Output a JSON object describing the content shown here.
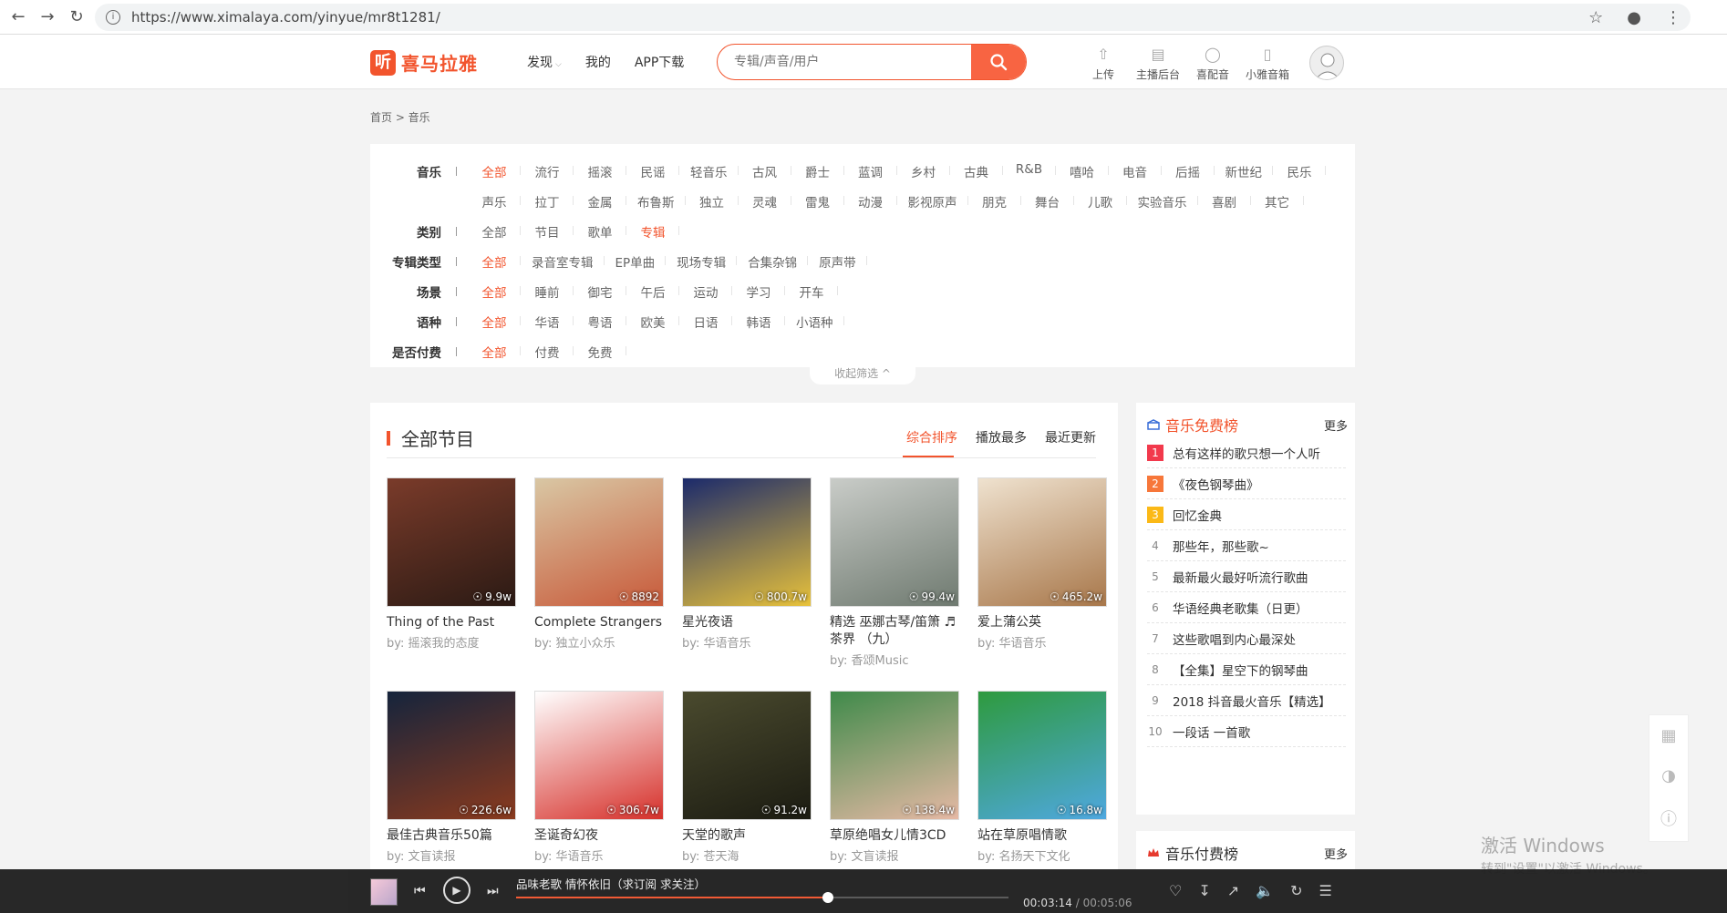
{
  "browser": {
    "url": "https://www.ximalaya.com/yinyue/mr8t1281/"
  },
  "header": {
    "logo_glyph": "听",
    "logo_text": "喜马拉雅",
    "nav": [
      "发现",
      "我的",
      "APP下载"
    ],
    "search_placeholder": "专辑/声音/用户",
    "tools": [
      {
        "label": "上传",
        "icon": "upload-icon"
      },
      {
        "label": "主播后台",
        "icon": "dashboard-icon"
      },
      {
        "label": "喜配音",
        "icon": "dubbing-icon"
      },
      {
        "label": "小雅音箱",
        "icon": "speaker-icon"
      }
    ]
  },
  "breadcrumb": "首页 > 音乐",
  "filters": [
    {
      "label": "音乐",
      "items": [
        "全部",
        "流行",
        "摇滚",
        "民谣",
        "轻音乐",
        "古风",
        "爵士",
        "蓝调",
        "乡村",
        "古典",
        "R&B",
        "嘻哈",
        "电音",
        "后摇",
        "新世纪",
        "民乐"
      ],
      "active": 0
    },
    {
      "label": "",
      "items": [
        "声乐",
        "拉丁",
        "金属",
        "布鲁斯",
        "独立",
        "灵魂",
        "雷鬼",
        "动漫",
        "影视原声",
        "朋克",
        "舞台",
        "儿歌",
        "实验音乐",
        "喜剧",
        "其它"
      ],
      "active": -1
    },
    {
      "label": "类别",
      "items": [
        "全部",
        "节目",
        "歌单",
        "专辑"
      ],
      "active": 3
    },
    {
      "label": "专辑类型",
      "items": [
        "全部",
        "录音室专辑",
        "EP单曲",
        "现场专辑",
        "合集杂锦",
        "原声带"
      ],
      "active": 0
    },
    {
      "label": "场景",
      "items": [
        "全部",
        "睡前",
        "御宅",
        "午后",
        "运动",
        "学习",
        "开车"
      ],
      "active": 0
    },
    {
      "label": "语种",
      "items": [
        "全部",
        "华语",
        "粤语",
        "欧美",
        "日语",
        "韩语",
        "小语种"
      ],
      "active": 0
    },
    {
      "label": "是否付费",
      "items": [
        "全部",
        "付费",
        "免费"
      ],
      "active": 0
    }
  ],
  "collapse_label": "收起筛选 ^",
  "section": {
    "title": "全部节目",
    "sort_tabs": [
      "综合排序",
      "播放最多",
      "最近更新"
    ],
    "sort_active": 0
  },
  "albums": [
    {
      "title": "Thing of the Past",
      "by": "by:  摇滚我的态度",
      "plays": "9.9w",
      "c1": "#7a3b2a",
      "c2": "#2b1a14"
    },
    {
      "title": "Complete Strangers",
      "by": "by:  独立小众乐",
      "plays": "8892",
      "c1": "#d9c7a4",
      "c2": "#c85a3a"
    },
    {
      "title": "星光夜语",
      "by": "by:  华语音乐",
      "plays": "800.7w",
      "c1": "#1b2a6b",
      "c2": "#e8c23b"
    },
    {
      "title": "精选 巫娜古琴/笛箫 ♬ 茶界 （九）",
      "by": "by:  香颂Music",
      "plays": "99.4w",
      "c1": "#c9ccc8",
      "c2": "#6f7a70"
    },
    {
      "title": "爱上蒲公英",
      "by": "by:  华语音乐",
      "plays": "465.2w",
      "c1": "#efe2cf",
      "c2": "#a8774a"
    },
    {
      "title": "最佳古典音乐50篇",
      "by": "by:  文盲读报",
      "plays": "226.6w",
      "c1": "#15243c",
      "c2": "#8a3a1e"
    },
    {
      "title": "圣诞奇幻夜",
      "by": "by:  华语音乐",
      "plays": "306.7w",
      "c1": "#ffffff",
      "c2": "#d6312b"
    },
    {
      "title": "天堂的歌声",
      "by": "by:  苍天海",
      "plays": "91.2w",
      "c1": "#4a4a2e",
      "c2": "#1c1c12"
    },
    {
      "title": "草原绝唱女儿情3CD",
      "by": "by:  文盲读报",
      "plays": "138.4w",
      "c1": "#3f8a4a",
      "c2": "#e6b9a5"
    },
    {
      "title": "站在草原唱情歌",
      "by": "by:  名扬天下文化",
      "plays": "16.8w",
      "c1": "#2e9a3e",
      "c2": "#4fa8e0"
    }
  ],
  "ranking_free": {
    "title": "音乐免费榜",
    "more": "更多",
    "items": [
      {
        "num": "1",
        "text": "总有这样的歌只想一个人听"
      },
      {
        "num": "2",
        "text": "《夜色钢琴曲》"
      },
      {
        "num": "3",
        "text": "回忆金典"
      },
      {
        "num": "4",
        "text": "那些年，那些歌~"
      },
      {
        "num": "5",
        "text": "最新最火最好听流行歌曲"
      },
      {
        "num": "6",
        "text": "华语经典老歌集（日更）"
      },
      {
        "num": "7",
        "text": "这些歌唱到内心最深处"
      },
      {
        "num": "8",
        "text": "【全集】星空下的钢琴曲"
      },
      {
        "num": "9",
        "text": "2018 抖音最火音乐【精选】"
      },
      {
        "num": "10",
        "text": "一段话 一首歌"
      }
    ]
  },
  "ranking_paid": {
    "title": "音乐付费榜",
    "more": "更多"
  },
  "watermark": {
    "line1": "激活 Windows",
    "line2": "转到\"设置\"以激活 Windows。"
  },
  "player": {
    "title": "品味老歌 情怀依旧（求订阅 求关注）",
    "current": "00:03:14",
    "total": "/ 00:05:06",
    "progress": 0.634
  },
  "colors": {
    "accent": "#f2542d"
  }
}
